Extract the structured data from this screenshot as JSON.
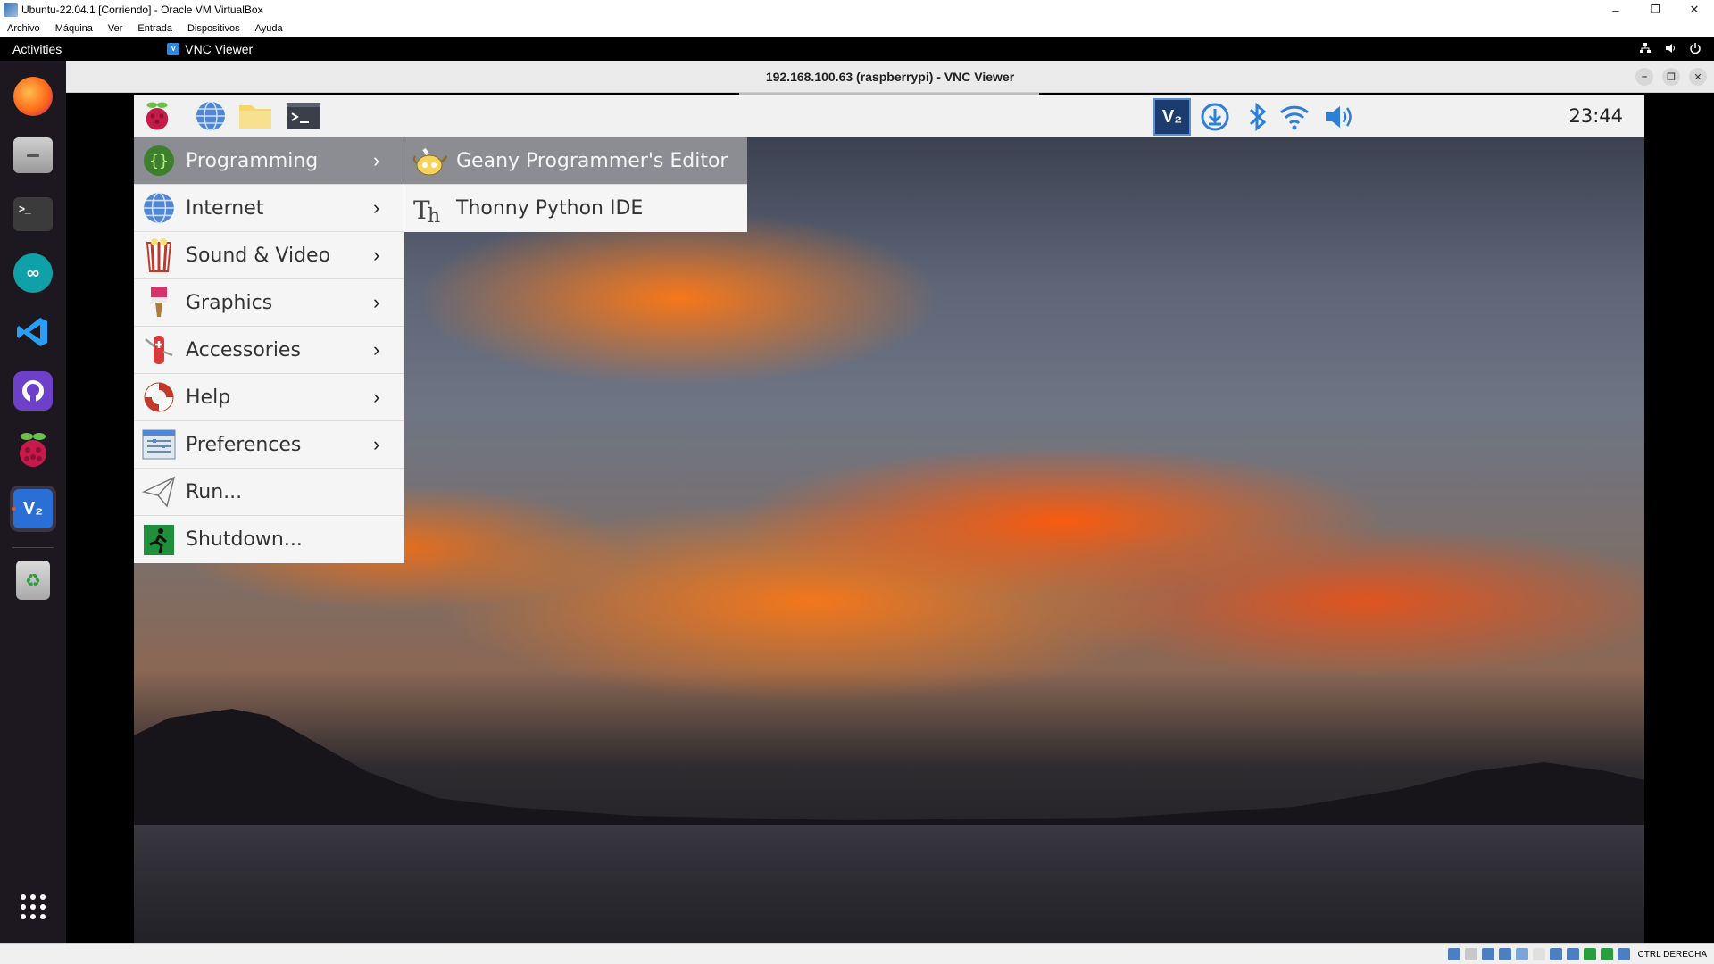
{
  "vbox": {
    "title": "Ubuntu-22.04.1 [Corriendo] - Oracle VM VirtualBox",
    "menu": [
      "Archivo",
      "Máquina",
      "Ver",
      "Entrada",
      "Dispositivos",
      "Ayuda"
    ],
    "controls": {
      "minimize": "–",
      "restore": "❐",
      "close": "✕"
    },
    "status_host_key": "CTRL DERECHA"
  },
  "ubuntu": {
    "activities": "Activities",
    "active_app": "VNC Viewer",
    "dock": [
      {
        "name": "firefox",
        "active": false
      },
      {
        "name": "files",
        "active": false
      },
      {
        "name": "terminal",
        "active": false
      },
      {
        "name": "arduino",
        "active": false
      },
      {
        "name": "vscode",
        "active": false
      },
      {
        "name": "github-desktop",
        "active": false
      },
      {
        "name": "raspberry-pi-imager",
        "active": false
      },
      {
        "name": "vnc-viewer",
        "active": true
      },
      {
        "name": "trash",
        "active": false
      },
      {
        "name": "show-applications",
        "active": false
      }
    ]
  },
  "vnc": {
    "title": "192.168.100.63 (raspberrypi) - VNC Viewer"
  },
  "rpi": {
    "clock": "23:44",
    "menu": [
      {
        "label": "Programming",
        "selected": true,
        "has_submenu": true
      },
      {
        "label": "Internet",
        "selected": false,
        "has_submenu": true
      },
      {
        "label": "Sound & Video",
        "selected": false,
        "has_submenu": true
      },
      {
        "label": "Graphics",
        "selected": false,
        "has_submenu": true
      },
      {
        "label": "Accessories",
        "selected": false,
        "has_submenu": true
      },
      {
        "label": "Help",
        "selected": false,
        "has_submenu": true
      },
      {
        "label": "Preferences",
        "selected": false,
        "has_submenu": true
      },
      {
        "label": "Run...",
        "selected": false,
        "has_submenu": false
      },
      {
        "label": "Shutdown...",
        "selected": false,
        "has_submenu": false
      }
    ],
    "submenu": [
      {
        "label": "Geany Programmer's Editor",
        "selected": true
      },
      {
        "label": "Thonny Python IDE",
        "selected": false
      }
    ],
    "arrow_glyph": "›"
  },
  "colors": {
    "menu_selected": "#8b8d92",
    "ubuntu_accent": "#e95420",
    "rpi_panel_bg": "#f1f1f1"
  }
}
